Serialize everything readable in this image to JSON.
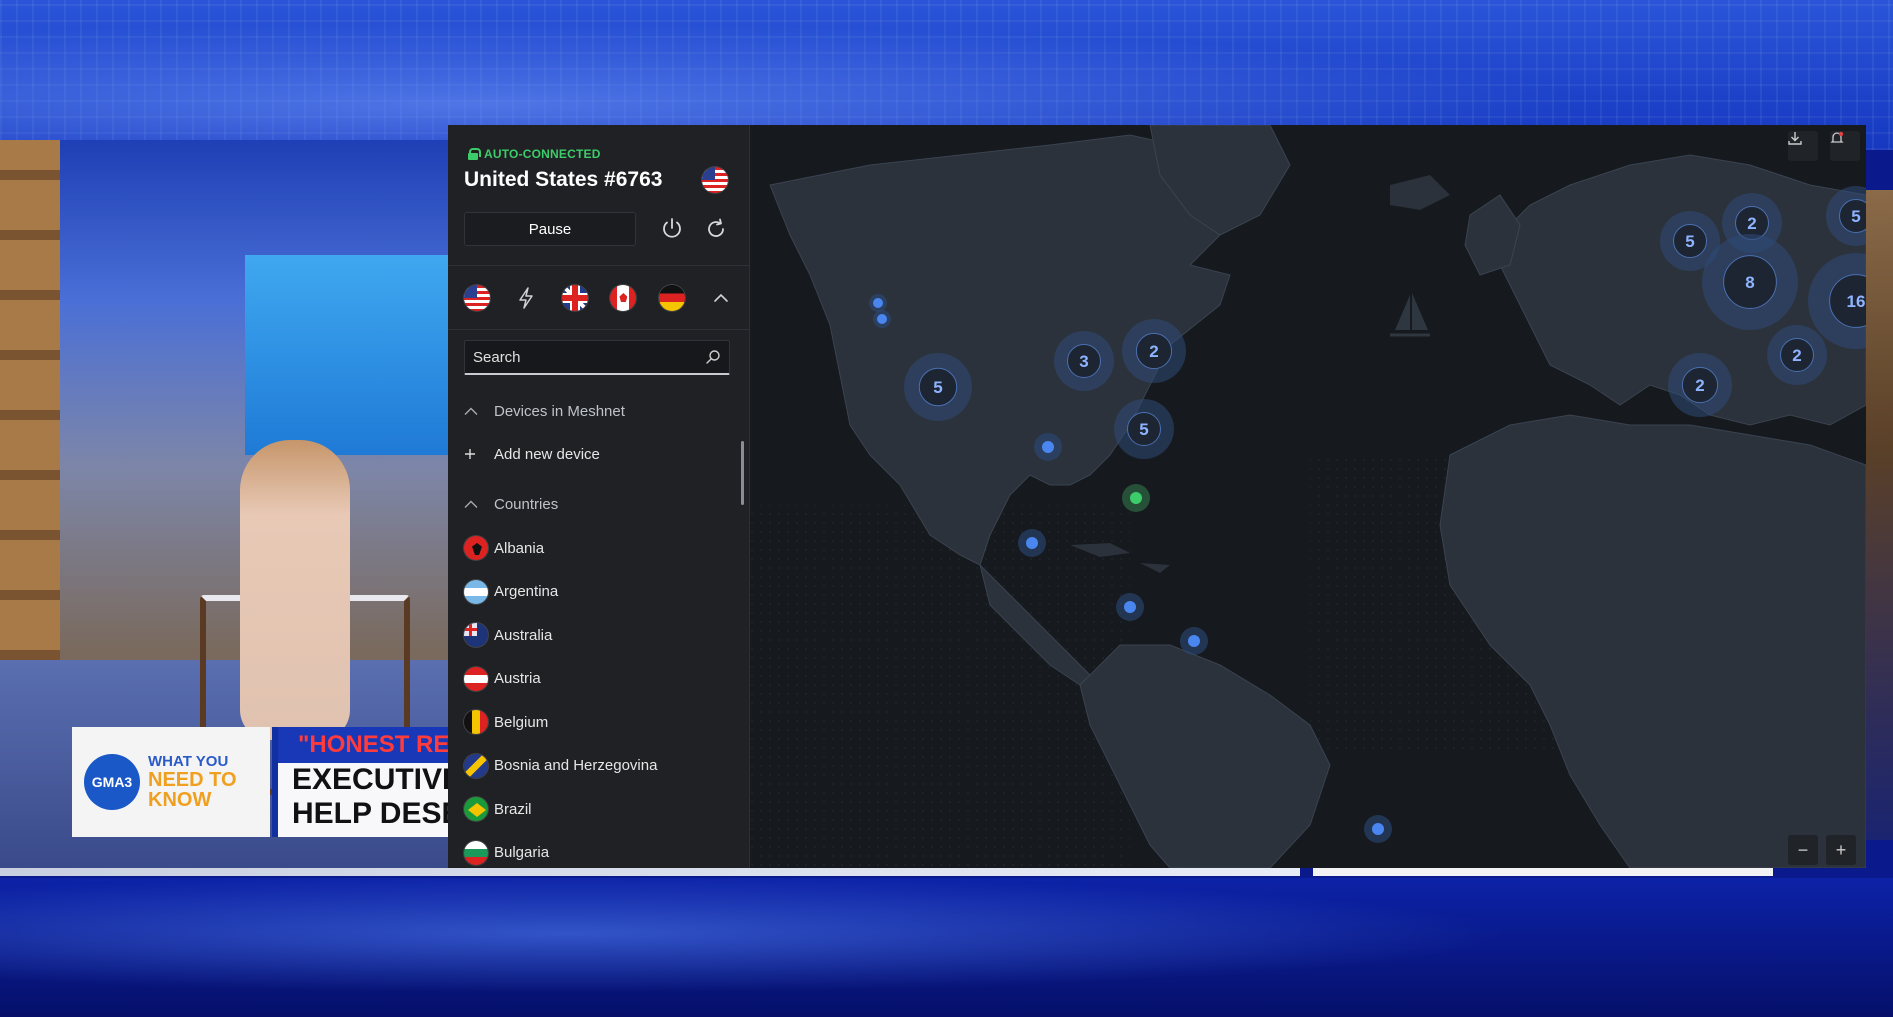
{
  "status": {
    "label": "AUTO-CONNECTED",
    "server": "United States #6763"
  },
  "controls": {
    "pause_label": "Pause"
  },
  "search": {
    "placeholder": "Search"
  },
  "meshnet": {
    "section_label": "Devices in Meshnet",
    "add_label": "Add new device"
  },
  "countries": {
    "section_label": "Countries",
    "items": [
      {
        "name": "Albania",
        "flag": "al"
      },
      {
        "name": "Argentina",
        "flag": "ar"
      },
      {
        "name": "Australia",
        "flag": "au"
      },
      {
        "name": "Austria",
        "flag": "at"
      },
      {
        "name": "Belgium",
        "flag": "be"
      },
      {
        "name": "Bosnia and Herzegovina",
        "flag": "ba"
      },
      {
        "name": "Brazil",
        "flag": "br"
      },
      {
        "name": "Bulgaria",
        "flag": "bg"
      }
    ]
  },
  "quick_connect": [
    "us-flag",
    "lightning-icon",
    "uk-flag",
    "canada-flag",
    "germany-flag",
    "chevron-up-icon"
  ],
  "map": {
    "clusters": [
      {
        "count": "5"
      },
      {
        "count": "3"
      },
      {
        "count": "2"
      },
      {
        "count": "5"
      },
      {
        "count": "2"
      },
      {
        "count": "5"
      },
      {
        "count": "8"
      },
      {
        "count": "5"
      },
      {
        "count": "16"
      },
      {
        "count": "2"
      },
      {
        "count": "2"
      }
    ],
    "zoom_out_label": "−",
    "zoom_in_label": "+"
  },
  "video": {
    "badge_logo": "GMA3",
    "badge_line1": "WHAT YOU",
    "badge_line2": "NEED TO",
    "badge_line3": "KNOW",
    "headline1": "\"HONEST REN",
    "headline2": "EXECUTIVE PR",
    "headline3": "HELP DESERVI"
  },
  "colors": {
    "connected": "#3dcc6a",
    "accent": "#4a86f0",
    "map_land": "#2b323b",
    "map_sea": "#16191d"
  }
}
